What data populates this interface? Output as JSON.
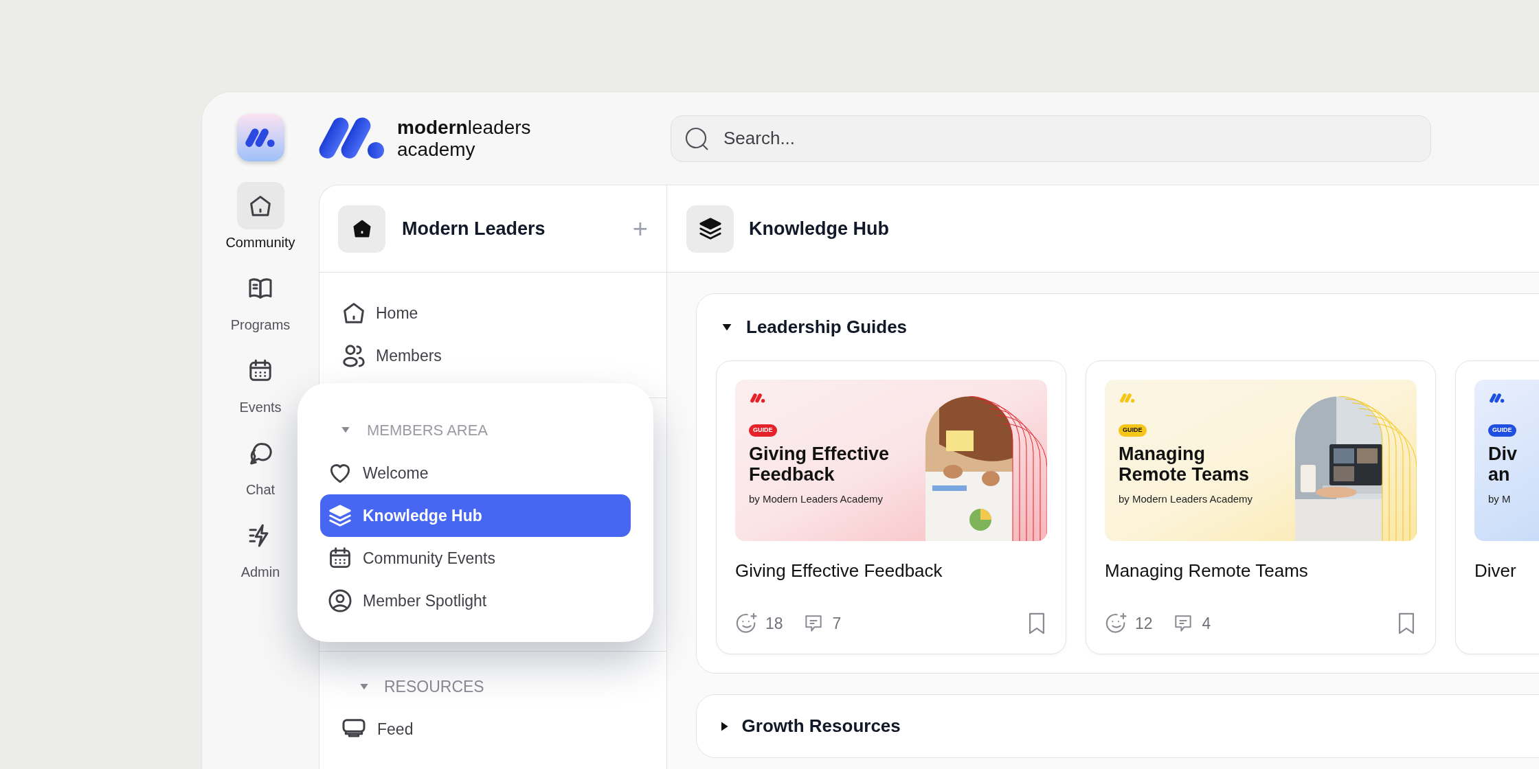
{
  "brand": {
    "name": "**modern**leaders",
    "tagline": "academy"
  },
  "search": {
    "placeholder": "Search..."
  },
  "rail": [
    {
      "label": "Community",
      "kind": "home",
      "selected": true
    },
    {
      "label": "Programs",
      "kind": "book",
      "selected": false
    },
    {
      "label": "Events",
      "kind": "calendar",
      "selected": false
    },
    {
      "label": "Chat",
      "kind": "chat",
      "selected": false
    },
    {
      "label": "Admin",
      "kind": "bolt",
      "selected": false
    }
  ],
  "space_panel": {
    "title": "Modern Leaders",
    "add": "+",
    "nav": [
      {
        "label": "Home",
        "kind": "home"
      },
      {
        "label": "Members",
        "kind": "members"
      }
    ],
    "sections": [
      {
        "title": "RESOURCES",
        "expanded": true,
        "items": [
          {
            "label": "Feed",
            "kind": "feed"
          }
        ]
      }
    ]
  },
  "popup": {
    "title": "MEMBERS AREA",
    "expanded": true,
    "items": [
      {
        "label": "Welcome",
        "kind": "heart",
        "selected": false
      },
      {
        "label": "Knowledge Hub",
        "kind": "layers",
        "selected": true
      },
      {
        "label": "Community Events",
        "kind": "calendar",
        "selected": false
      },
      {
        "label": "Member Spotlight",
        "kind": "user",
        "selected": false
      }
    ]
  },
  "content": {
    "title": "Knowledge Hub",
    "sections": [
      {
        "title": "Leadership Guides",
        "expanded": true,
        "cards": [
          {
            "color": "#e5222a",
            "badge": "GUIDE",
            "headline": [
              "Giving Effective",
              "Feedback"
            ],
            "byline": "by Modern Leaders Academy",
            "title": "Giving Effective Feedback",
            "reactions": "18",
            "comments": "7"
          },
          {
            "color": "#f5c518",
            "badge": "GUIDE",
            "headline": [
              "Managing",
              "Remote Teams"
            ],
            "byline": "by Modern Leaders Academy",
            "title": "Managing Remote Teams",
            "reactions": "12",
            "comments": "4"
          },
          {
            "color": "#1f4fe0",
            "badge": "GUIDE",
            "headline": [
              "Div",
              "an"
            ],
            "byline": "by M",
            "title": "Diver"
          }
        ]
      },
      {
        "title": "Growth Resources",
        "expanded": false
      }
    ]
  }
}
